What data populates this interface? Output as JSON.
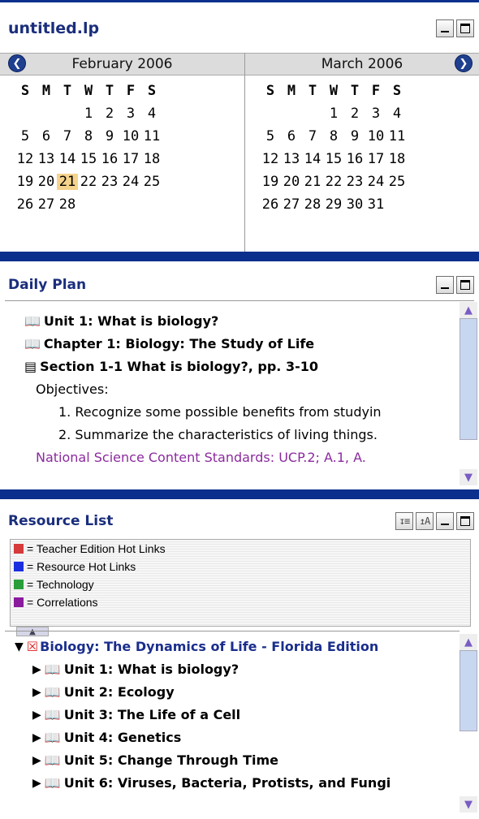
{
  "app": {
    "title": "untitled.lp"
  },
  "calendar": {
    "left": {
      "month": "February 2006",
      "weekdays": [
        "S",
        "M",
        "T",
        "W",
        "T",
        "F",
        "S"
      ],
      "weeks": [
        [
          "",
          "",
          "",
          "1",
          "2",
          "3",
          "4"
        ],
        [
          "5",
          "6",
          "7",
          "8",
          "9",
          "10",
          "11"
        ],
        [
          "12",
          "13",
          "14",
          "15",
          "16",
          "17",
          "18"
        ],
        [
          "19",
          "20",
          "21",
          "22",
          "23",
          "24",
          "25"
        ],
        [
          "26",
          "27",
          "28",
          "",
          "",
          "",
          ""
        ]
      ],
      "highlight": "21"
    },
    "right": {
      "month": "March 2006",
      "weekdays": [
        "S",
        "M",
        "T",
        "W",
        "T",
        "F",
        "S"
      ],
      "weeks": [
        [
          "",
          "",
          "",
          "1",
          "2",
          "3",
          "4"
        ],
        [
          "5",
          "6",
          "7",
          "8",
          "9",
          "10",
          "11"
        ],
        [
          "12",
          "13",
          "14",
          "15",
          "16",
          "17",
          "18"
        ],
        [
          "19",
          "20",
          "21",
          "22",
          "23",
          "24",
          "25"
        ],
        [
          "26",
          "27",
          "28",
          "29",
          "30",
          "31",
          ""
        ]
      ]
    },
    "prev_icon": "chevron-left-icon",
    "next_icon": "chevron-right-icon"
  },
  "daily_plan": {
    "title": "Daily Plan",
    "unit": "Unit 1: What is biology?",
    "chapter": "Chapter 1: Biology: The Study of Life",
    "section": "Section 1-1 What is biology?, pp. 3-10",
    "objectives_label": "Objectives:",
    "objectives": [
      "1. Recognize some possible benefits from studyin",
      "2. Summarize the characteristics of living things."
    ],
    "standards": "National Science Content Standards: UCP.2; A.1, A."
  },
  "resource_list": {
    "title": "Resource List",
    "legend": [
      {
        "color": "#d63a3a",
        "label": "= Teacher Edition Hot Links"
      },
      {
        "color": "#1a2ee0",
        "label": "= Resource Hot Links"
      },
      {
        "color": "#2a9e3a",
        "label": "= Technology"
      },
      {
        "color": "#8a1a9e",
        "label": "= Correlations"
      }
    ],
    "root": "Biology: The Dynamics of Life - Florida Edition",
    "units": [
      "Unit 1: What is biology?",
      "Unit 2: Ecology",
      "Unit 3: The Life of a Cell",
      "Unit 4: Genetics",
      "Unit 5: Change Through Time",
      "Unit 6: Viruses, Bacteria, Protists, and Fungi"
    ]
  },
  "colors": {
    "accent": "#0a2f8c",
    "title_text": "#1a2e7c",
    "highlight_day": "#f5d38c",
    "standards": "#8b2a9e"
  }
}
